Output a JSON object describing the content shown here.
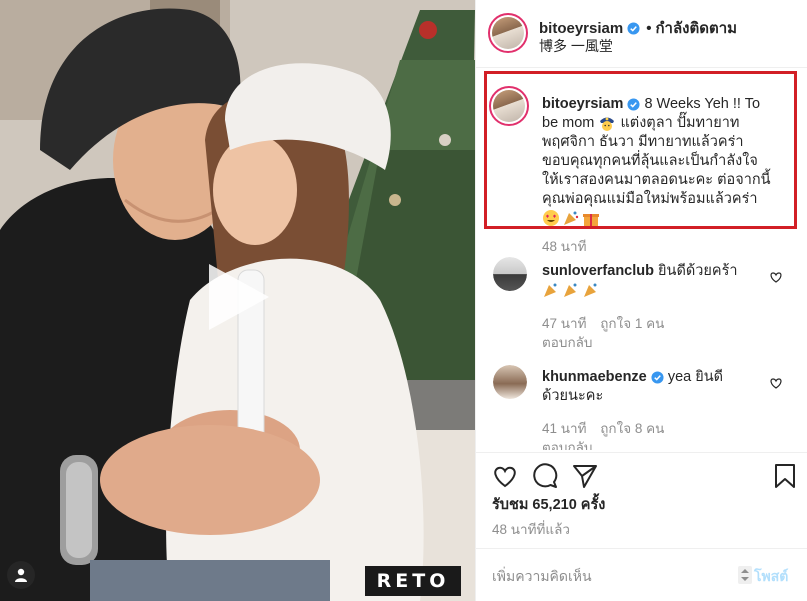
{
  "post": {
    "header": {
      "username": "bitoeyrsiam",
      "separator": "•",
      "follow_label": "กำลังติดตาม",
      "location": "博多 一風堂"
    },
    "caption": {
      "username": "bitoeyrsiam",
      "line1": "8 Weeks Yeh !! To",
      "line2a": "be mom",
      "line2b": "แต่งตุลา ปั๊มทายาท",
      "line3": "พฤศจิกา ธันวา มีทายาทแล้วคร่า",
      "line4": "ขอบคุณทุกคนที่ลุ้นและเป็นกำลังใจ",
      "line5": "ให้เราสองคนมาตลอดนะคะ ต่อจากนี้",
      "line6": "คุณพ่อคุณแม่มือใหม่พร้อมแล้วคร่า",
      "time": "48 นาที"
    },
    "comments": [
      {
        "username": "sunloverfanclub",
        "text": "ยินดีด้วยคร้า",
        "time": "47 นาที",
        "likes": "ถูกใจ 1 คน",
        "reply": "ตอบกลับ"
      },
      {
        "username": "khunmaebenze",
        "text_line1": "yea ยินดี",
        "text_line2": "ด้วยนะคะ",
        "time": "41 นาที",
        "likes": "ถูกใจ 8 คน",
        "reply": "ตอบกลับ"
      }
    ],
    "likes_count": "รับชม 65,210 ครั้ง",
    "posted_ago": "48 นาทีที่แล้ว",
    "add_comment_placeholder": "เพิ่มความคิดเห็น",
    "post_button": "โพสต์",
    "watermark": "RETO"
  },
  "icons": {
    "verified": "verified-badge-icon",
    "heart": "heart-icon",
    "comment": "comment-icon",
    "share": "share-icon",
    "save": "bookmark-icon",
    "play": "play-icon",
    "user_tag": "user-tag-icon"
  },
  "colors": {
    "highlight_box": "#d21f26",
    "verified": "#3897f0",
    "post_button": "#b2dffc",
    "muted_text": "#8e8e8e"
  }
}
